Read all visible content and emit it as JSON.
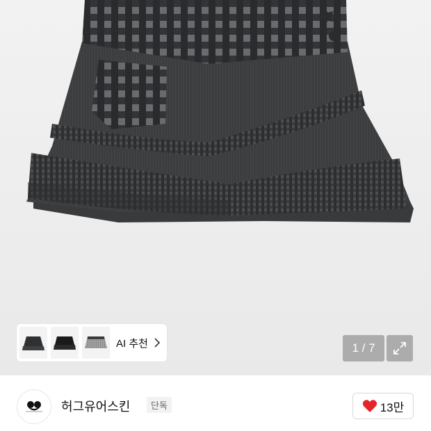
{
  "gallery": {
    "ai_recommend_label": "AI 추천",
    "thumbnails": [
      {
        "name": "dark-skirt-1"
      },
      {
        "name": "black-skirt-2"
      },
      {
        "name": "gray-skirt-3"
      }
    ],
    "pager_text": "1 / 7"
  },
  "brand": {
    "name": "허그유어스킨",
    "badge": "단독",
    "logo_text": "hugyourskin"
  },
  "like": {
    "count": "13만",
    "color": "#e5252a"
  },
  "icons": [
    "heart-icon",
    "expand-icon",
    "chevron-right-icon",
    "brand-logo"
  ]
}
